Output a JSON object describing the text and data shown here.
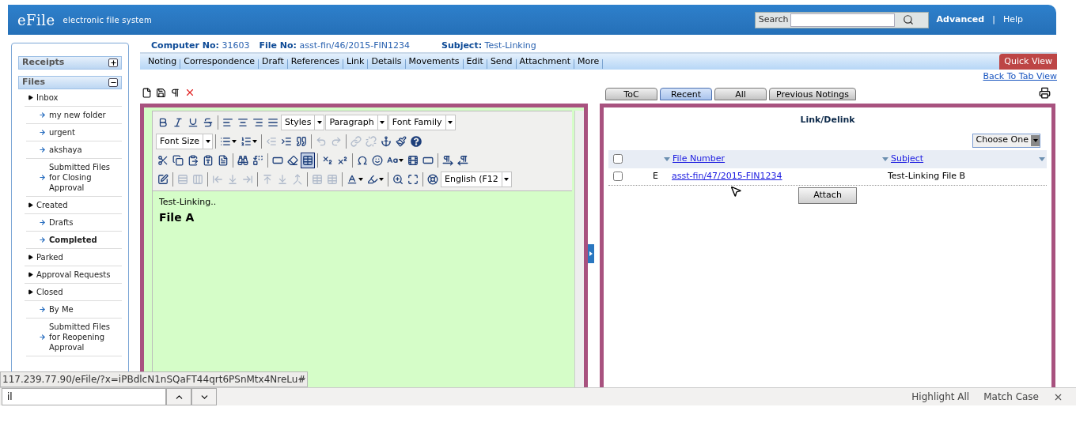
{
  "header": {
    "logo": "eFile",
    "tagline": "electronic file system",
    "search": {
      "label": "Search"
    },
    "links": [
      "Advanced",
      "Help"
    ],
    "link_separator": "|"
  },
  "sidebar": {
    "sections": [
      {
        "title": "Receipts",
        "expanded": false
      },
      {
        "title": "Files",
        "expanded": true,
        "items": [
          {
            "label": "Inbox",
            "selected": false,
            "children": [
              {
                "label": "my new folder",
                "selected": false
              },
              {
                "label": "urgent",
                "selected": false
              },
              {
                "label": "akshaya",
                "selected": false
              },
              {
                "label": "Submitted Files for Closing Approval",
                "selected": false
              }
            ]
          },
          {
            "label": "Created",
            "selected": false,
            "children": [
              {
                "label": "Drafts",
                "selected": false
              },
              {
                "label": "Completed",
                "selected": true
              }
            ]
          },
          {
            "label": "Parked",
            "selected": false
          },
          {
            "label": "Approval Requests",
            "selected": false
          },
          {
            "label": "Closed",
            "selected": false,
            "children": [
              {
                "label": "By Me",
                "selected": false
              },
              {
                "label": "Submitted Files for Reopening Approval",
                "selected": false
              }
            ]
          }
        ]
      }
    ]
  },
  "file_info": [
    {
      "label": "Computer No:",
      "value": "31603"
    },
    {
      "label": "File No:",
      "value": "asst-fin/46/2015-FIN1234"
    },
    {
      "label": "Subject:",
      "value": "Test-Linking"
    }
  ],
  "menu": [
    "Noting",
    "Correspondence",
    "Draft",
    "References",
    "Link",
    "Details",
    "Movements",
    "Edit",
    "Send",
    "Attachment",
    "More"
  ],
  "quick_view": "Quick View",
  "back_link": "Back To Tab View",
  "view_tabs": [
    {
      "label": "ToC",
      "selected": false
    },
    {
      "label": "Recent",
      "selected": true
    },
    {
      "label": "All",
      "selected": false
    },
    {
      "label": "Previous Notings",
      "selected": false
    }
  ],
  "editor": {
    "toolbar": {
      "rows": [
        [
          {
            "kind": "button",
            "disabled": false,
            "selected": false,
            "menu": false
          },
          {
            "kind": "button",
            "disabled": false,
            "selected": false,
            "menu": false
          },
          {
            "kind": "button",
            "disabled": false,
            "selected": false,
            "menu": false
          },
          {
            "kind": "button",
            "disabled": false,
            "selected": false,
            "menu": false
          },
          {
            "kind": "separator"
          },
          {
            "kind": "button",
            "disabled": false,
            "selected": false,
            "menu": false
          },
          {
            "kind": "button",
            "disabled": false,
            "selected": false,
            "menu": false
          },
          {
            "kind": "button",
            "disabled": false,
            "selected": false,
            "menu": false
          },
          {
            "kind": "button",
            "disabled": false,
            "selected": false,
            "menu": false
          },
          {
            "kind": "select",
            "value": "Styles"
          },
          {
            "kind": "select",
            "value": "Paragraph"
          },
          {
            "kind": "select",
            "value": "Font Family"
          }
        ],
        [
          {
            "kind": "select",
            "value": "Font Size"
          },
          {
            "kind": "separator"
          },
          {
            "kind": "button",
            "disabled": false,
            "selected": false,
            "menu": true
          },
          {
            "kind": "button",
            "disabled": false,
            "selected": false,
            "menu": true
          },
          {
            "kind": "separator"
          },
          {
            "kind": "button",
            "disabled": true,
            "selected": false,
            "menu": false
          },
          {
            "kind": "button",
            "disabled": false,
            "selected": false,
            "menu": false
          },
          {
            "kind": "button",
            "disabled": false,
            "selected": false,
            "menu": false
          },
          {
            "kind": "separator"
          },
          {
            "kind": "button",
            "disabled": true,
            "selected": false,
            "menu": false
          },
          {
            "kind": "button",
            "disabled": true,
            "selected": false,
            "menu": false
          },
          {
            "kind": "separator"
          },
          {
            "kind": "button",
            "disabled": true,
            "selected": false,
            "menu": false
          },
          {
            "kind": "button",
            "disabled": true,
            "selected": false,
            "menu": false
          },
          {
            "kind": "button",
            "disabled": false,
            "selected": false,
            "menu": false
          },
          {
            "kind": "button",
            "disabled": false,
            "selected": false,
            "menu": false
          },
          {
            "kind": "button",
            "disabled": false,
            "selected": false,
            "menu": false
          }
        ],
        [
          {
            "kind": "button",
            "disabled": false,
            "selected": false,
            "menu": false
          },
          {
            "kind": "button",
            "disabled": false,
            "selected": false,
            "menu": false
          },
          {
            "kind": "button",
            "disabled": false,
            "selected": false,
            "menu": false
          },
          {
            "kind": "button",
            "disabled": false,
            "selected": false,
            "menu": false
          },
          {
            "kind": "button",
            "disabled": false,
            "selected": false,
            "menu": false
          },
          {
            "kind": "separator"
          },
          {
            "kind": "button",
            "disabled": false,
            "selected": false,
            "menu": false
          },
          {
            "kind": "button",
            "disabled": false,
            "selected": false,
            "menu": false
          },
          {
            "kind": "separator"
          },
          {
            "kind": "button",
            "disabled": false,
            "selected": false,
            "menu": false
          },
          {
            "kind": "button",
            "disabled": false,
            "selected": false,
            "menu": false
          },
          {
            "kind": "button",
            "disabled": false,
            "selected": true,
            "menu": false
          },
          {
            "kind": "separator"
          },
          {
            "kind": "button",
            "disabled": false,
            "selected": false,
            "menu": false
          },
          {
            "kind": "button",
            "disabled": false,
            "selected": false,
            "menu": false
          },
          {
            "kind": "separator"
          },
          {
            "kind": "button",
            "disabled": false,
            "selected": false,
            "menu": false
          },
          {
            "kind": "button",
            "disabled": false,
            "selected": false,
            "menu": false
          },
          {
            "kind": "button",
            "disabled": false,
            "selected": false,
            "menu": true
          },
          {
            "kind": "button",
            "disabled": false,
            "selected": false,
            "menu": false
          },
          {
            "kind": "button",
            "disabled": false,
            "selected": false,
            "menu": false
          },
          {
            "kind": "separator"
          },
          {
            "kind": "button",
            "disabled": false,
            "selected": false,
            "menu": false
          },
          {
            "kind": "button",
            "disabled": false,
            "selected": false,
            "menu": false
          }
        ],
        [
          {
            "kind": "button",
            "disabled": false,
            "selected": false,
            "menu": false
          },
          {
            "kind": "separator"
          },
          {
            "kind": "button",
            "disabled": true,
            "selected": false,
            "menu": false
          },
          {
            "kind": "button",
            "disabled": true,
            "selected": false,
            "menu": false
          },
          {
            "kind": "separator"
          },
          {
            "kind": "button",
            "disabled": true,
            "selected": false,
            "menu": false
          },
          {
            "kind": "button",
            "disabled": true,
            "selected": false,
            "menu": false
          },
          {
            "kind": "button",
            "disabled": true,
            "selected": false,
            "menu": false
          },
          {
            "kind": "separator"
          },
          {
            "kind": "button",
            "disabled": true,
            "selected": false,
            "menu": false
          },
          {
            "kind": "button",
            "disabled": true,
            "selected": false,
            "menu": false
          },
          {
            "kind": "button",
            "disabled": true,
            "selected": false,
            "menu": false
          },
          {
            "kind": "separator"
          },
          {
            "kind": "button",
            "disabled": true,
            "selected": false,
            "menu": false
          },
          {
            "kind": "button",
            "disabled": true,
            "selected": false,
            "menu": false
          },
          {
            "kind": "separator"
          },
          {
            "kind": "button",
            "disabled": false,
            "selected": false,
            "menu": true
          },
          {
            "kind": "button",
            "disabled": false,
            "selected": false,
            "menu": true
          },
          {
            "kind": "separator"
          },
          {
            "kind": "button",
            "disabled": false,
            "selected": false,
            "menu": false
          },
          {
            "kind": "button",
            "disabled": false,
            "selected": false,
            "menu": false
          },
          {
            "kind": "separator"
          },
          {
            "kind": "button",
            "disabled": false,
            "selected": false,
            "menu": false
          },
          {
            "kind": "select",
            "value": "English (F12"
          }
        ]
      ]
    },
    "content": [
      {
        "kind": "paragraph",
        "text": "Test-Linking.."
      },
      {
        "kind": "heading",
        "text": "File A"
      }
    ]
  },
  "link_panel": {
    "title": "Link/Delink",
    "filter": "Choose One",
    "header_checked": false,
    "columns": [
      "File Number",
      "Subject"
    ],
    "rows": [
      {
        "checked": false,
        "type": "E",
        "file_number": "asst-fin/47/2015-FIN1234",
        "subject": "Test-Linking File B"
      }
    ],
    "action": "Attach"
  },
  "status_url": "117.239.77.90/eFile/?x=iPBdlcN1nSQaFT44qrt6PSnMtx4NreLu#",
  "find_bar": {
    "value": "il",
    "options": [
      "Highlight All",
      "Match Case"
    ]
  }
}
